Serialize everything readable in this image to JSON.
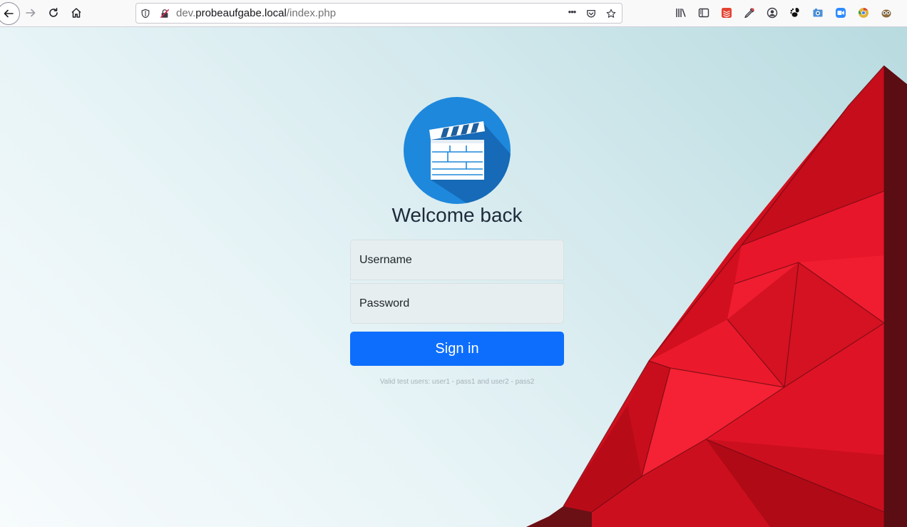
{
  "browser": {
    "url_prefix": "dev.",
    "url_host": "probeaufgabe.local",
    "url_path": "/index.php",
    "more_label": "•••"
  },
  "login": {
    "title": "Welcome back",
    "username_placeholder": "Username",
    "password_placeholder": "Password",
    "signin_label": "Sign in",
    "hint": "Valid test users: user1 - pass1 and user2 - pass2"
  },
  "colors": {
    "button": "#0d6efd",
    "logo_circle": "#1e88dc",
    "building_red": "#e0101f"
  },
  "icons": [
    "back-icon",
    "forward-icon",
    "reload-icon",
    "home-icon",
    "shield-icon",
    "insecure-lock-icon",
    "more-icon",
    "pocket-icon",
    "bookmark-star-icon",
    "library-icon",
    "sidebar-icon",
    "todoist-icon",
    "eyedropper-icon",
    "account-icon",
    "gnome-icon",
    "screenshot-icon",
    "zoom-icon",
    "chrome-icon",
    "owl-icon",
    "clapperboard-icon"
  ]
}
